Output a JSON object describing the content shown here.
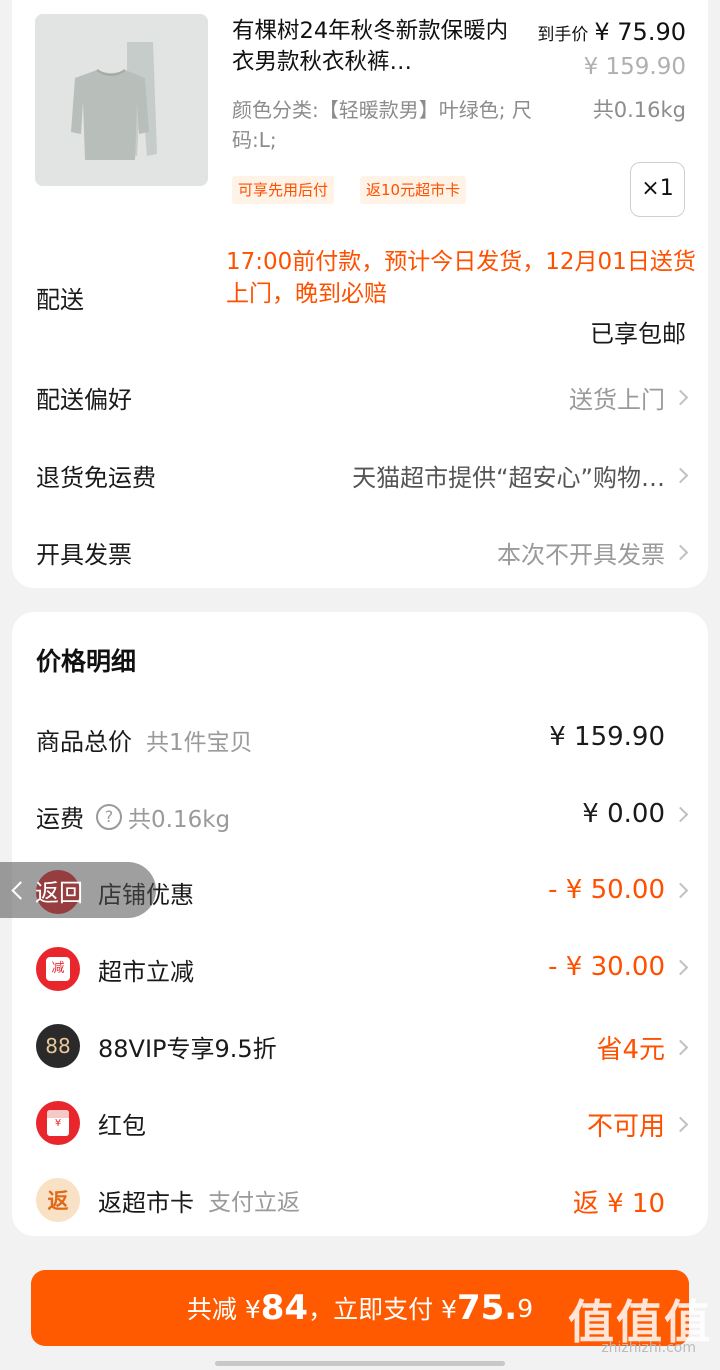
{
  "product": {
    "title": "有棵树24年秋冬新款保暖内衣男款秋衣秋裤…",
    "final_price_label": "到手价",
    "final_price": "¥ 75.90",
    "original_price": "¥ 159.90",
    "spec": "颜色分类:【轻暖款男】叶绿色; 尺码:L;",
    "weight": "共0.16kg",
    "tags": [
      "可享先用后付",
      "返10元超市卡"
    ],
    "quantity": "×1"
  },
  "delivery": {
    "label": "配送",
    "promise": "17:00前付款，预计今日发货，12月01日送货上门，晚到必赔",
    "free_shipping": "已享包邮"
  },
  "rows": [
    {
      "label": "配送偏好",
      "value": "送货上门"
    },
    {
      "label": "退货免运费",
      "value": "天猫超市提供“超安心”购物…"
    },
    {
      "label": "开具发票",
      "value": "本次不开具发票"
    }
  ],
  "price_detail": {
    "title": "价格明细",
    "total": {
      "label": "商品总价",
      "sub": "共1件宝贝",
      "value": "¥ 159.90"
    },
    "shipping": {
      "label": "运费",
      "sub": "共0.16kg",
      "value": "¥ 0.00"
    },
    "shop_discount": {
      "label": "店铺优惠",
      "value": "- ¥ 50.00"
    },
    "market_discount": {
      "label": "超市立减",
      "icon_text": "减",
      "value": "- ¥ 30.00"
    },
    "vip": {
      "label": "88VIP专享9.5折",
      "icon_text": "88",
      "value": "省4元"
    },
    "red_packet": {
      "label": "红包",
      "icon_text": "¥",
      "value": "不可用"
    },
    "card_return": {
      "label": "返超市卡",
      "sub": "支付立返",
      "icon_text": "返",
      "value": "返 ¥ 10"
    }
  },
  "back": {
    "label": "返回"
  },
  "pay": {
    "prefix": "共减 ¥",
    "saved": "84",
    "middle": "，立即支付 ¥",
    "amount": "75.",
    "amount_tail": "9"
  },
  "watermark": {
    "text": "值值值",
    "sub": "zhizhizhi.com"
  },
  "colors": {
    "accent": "#ff5000",
    "button": "#ff5a00"
  }
}
